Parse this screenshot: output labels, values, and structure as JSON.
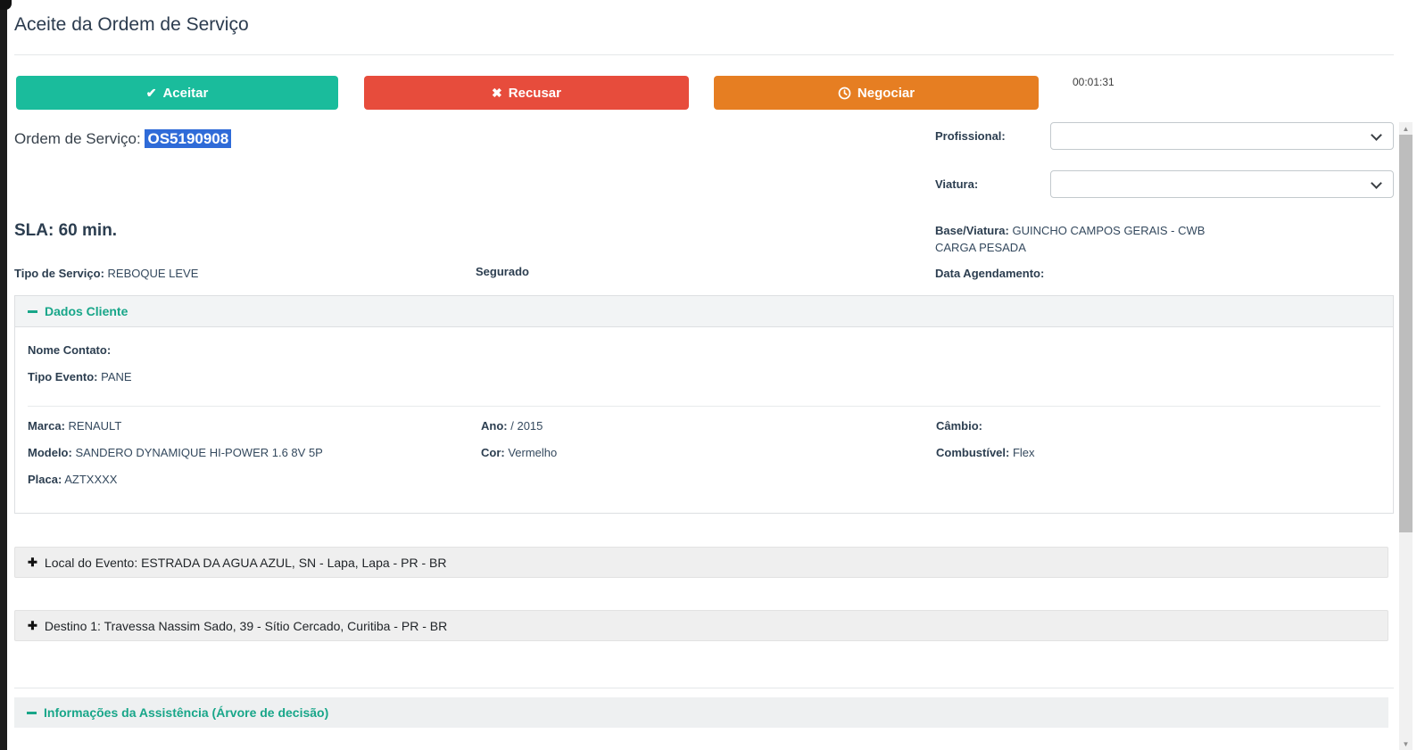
{
  "colors": {
    "accept_green": "#1abc9c",
    "refuse_red": "#e74c3c",
    "negotiate_orange": "#e67e22",
    "section_green": "#18a689",
    "selection_blue": "#2f6bd8"
  },
  "icons": {
    "check": "✔",
    "x": "✖",
    "plus": "✚",
    "scroll_up": "▲",
    "scroll_down": "▼"
  },
  "modal": {
    "title": "Aceite da Ordem de Serviço"
  },
  "actions": {
    "accept_label": "Aceitar",
    "refuse_label": "Recusar",
    "negotiate_label": "Negociar",
    "timer": "00:01:31"
  },
  "order": {
    "label": "Ordem de Serviço:",
    "value": "OS5190908"
  },
  "assign_form": {
    "profissional_label": "Profissional:",
    "profissional_value": "",
    "viatura_label": "Viatura:",
    "viatura_value": ""
  },
  "summary": {
    "sla": "SLA: 60 min.",
    "base_viatura_label": "Base/Viatura:",
    "base_viatura_value": "GUINCHO CAMPOS GERAIS - CWB CARGA PESADA",
    "tipo_servico_label": "Tipo de Serviço:",
    "tipo_servico_value": "REBOQUE LEVE",
    "segurado": "Segurado",
    "data_agendamento_label": "Data Agendamento:",
    "data_agendamento_value": ""
  },
  "dados_cliente": {
    "title": "Dados Cliente",
    "nome_contato_label": "Nome Contato:",
    "nome_contato_value": "",
    "tipo_evento_label": "Tipo Evento:",
    "tipo_evento_value": "PANE",
    "marca_label": "Marca:",
    "marca_value": "RENAULT",
    "modelo_label": "Modelo:",
    "modelo_value": "SANDERO DYNAMIQUE HI-POWER 1.6 8V 5P",
    "placa_label": "Placa:",
    "placa_value": "AZTXXXX",
    "ano_label": "Ano:",
    "ano_value": "/ 2015",
    "cor_label": "Cor:",
    "cor_value": "Vermelho",
    "cambio_label": "Câmbio:",
    "cambio_value": "",
    "combustivel_label": "Combustível:",
    "combustivel_value": "Flex"
  },
  "locations": {
    "local_evento": "Local do Evento: ESTRADA DA AGUA AZUL, SN - Lapa, Lapa - PR - BR",
    "destino_1": "Destino 1: Travessa Nassim Sado, 39 - Sítio Cercado, Curitiba - PR - BR"
  },
  "assistencia": {
    "title": "Informações da Assistência (Árvore de decisão)"
  }
}
